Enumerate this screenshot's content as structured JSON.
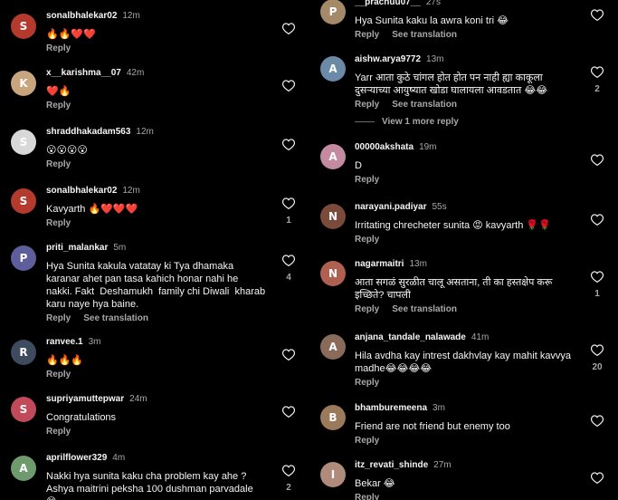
{
  "actions": {
    "reply": "Reply",
    "see_translation": "See translation"
  },
  "left": [
    {
      "user": "sonalbhalekar02",
      "time": "12m",
      "text": "🔥🔥❤️❤️",
      "likes": "",
      "translation": false,
      "avatar_color": "#b43a2e",
      "avatar_letter": "S"
    },
    {
      "user": "x__karishma__07",
      "time": "42m",
      "text": "❤️🔥",
      "likes": "",
      "translation": false,
      "avatar_color": "#c9a57e",
      "avatar_letter": "K"
    },
    {
      "user": "shraddhakadam563",
      "time": "12m",
      "text": "😮😮😮😮",
      "likes": "",
      "translation": false,
      "avatar_color": "#d8d8d8",
      "avatar_letter": "S"
    },
    {
      "user": "sonalbhalekar02",
      "time": "12m",
      "text": "Kavyarth 🔥❤️❤️❤️",
      "likes": "1",
      "translation": false,
      "avatar_color": "#b43a2e",
      "avatar_letter": "S"
    },
    {
      "user": "priti_malankar",
      "time": "5m",
      "text": "Hya Sunita kakula vatatay ki Tya dhamaka\nkaranar ahet pan tasa kahich honar nahi he\nnakki. Fakt  Deshamukh  family chi Diwali  kharab\nkaru naye hya baine.",
      "likes": "4",
      "translation": true,
      "avatar_color": "#5f5e9c",
      "avatar_letter": "P"
    },
    {
      "user": "ranvee.1",
      "time": "3m",
      "text": "🔥🔥🔥",
      "likes": "",
      "translation": false,
      "avatar_color": "#3e4a5e",
      "avatar_letter": "R"
    },
    {
      "user": "supriyamuttepwar",
      "time": "24m",
      "text": "Congratulations",
      "likes": "",
      "translation": false,
      "avatar_color": "#c04a5a",
      "avatar_letter": "S"
    },
    {
      "user": "aprilflower329",
      "time": "4m",
      "text": "Nakki hya sunita kaku cha problem kay ahe ?\nAshya maitrini peksha 100 dushman parvadale\n😊",
      "likes": "2",
      "translation": false,
      "avatar_color": "#6f9a6e",
      "avatar_letter": "A"
    }
  ],
  "right": [
    {
      "user": "__prachuu07__",
      "time": "27s",
      "text": "Hya Sunita kaku la awra koni tri 😂",
      "likes": "",
      "translation": true,
      "avatar_color": "#a58a6a",
      "avatar_letter": "P"
    },
    {
      "user": "aishw.arya9772",
      "time": "13m",
      "text": "Yarr आता कुठे चांगल होत होत पन नाही ह्या काकूला\nदुसऱ्याच्या आयुष्यात खोडा घालायला आवडतात 😂😂",
      "likes": "2",
      "translation": true,
      "avatar_color": "#6a8aa8",
      "avatar_letter": "A",
      "more_replies": "View 1 more reply"
    },
    {
      "user": "00000akshata",
      "time": "19m",
      "text": "D",
      "likes": "",
      "translation": false,
      "avatar_color": "#c48aa0",
      "avatar_letter": "A"
    },
    {
      "user": "narayani.padiyar",
      "time": "55s",
      "text": "Irritating chrecheter sunita 😡 kavyarth 🌹🌹",
      "likes": "",
      "translation": false,
      "avatar_color": "#7a4a3a",
      "avatar_letter": "N"
    },
    {
      "user": "nagarmaitri",
      "time": "13m",
      "text": "आता सगळं सुरळीत चालू असताना, ती का हस्तक्षेप करू\nइच्छिते? चापली",
      "likes": "1",
      "translation": true,
      "avatar_color": "#b06050",
      "avatar_letter": "N"
    },
    {
      "user": "anjana_tandale_nalawade",
      "time": "41m",
      "text": "Hila avdha kay intrest dakhvlay kay mahit kavvya\nmadhe😂😂😂😂",
      "likes": "20",
      "translation": false,
      "avatar_color": "#8a6a5a",
      "avatar_letter": "A"
    },
    {
      "user": "bhamburemeena",
      "time": "3m",
      "text": "Friend are not friend but enemy too",
      "likes": "",
      "translation": false,
      "avatar_color": "#9a7a5a",
      "avatar_letter": "B"
    },
    {
      "user": "itz_revati_shinde",
      "time": "27m",
      "text": "Bekar 😂",
      "likes": "",
      "translation": false,
      "avatar_color": "#b08a7a",
      "avatar_letter": "I"
    }
  ]
}
